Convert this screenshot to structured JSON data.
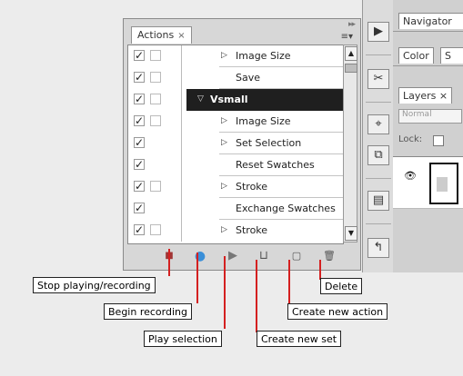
{
  "actions_panel": {
    "tab_label": "Actions",
    "tab_close": "×",
    "menu_glyph": "▸▸",
    "rows": [
      {
        "label": "Image Size",
        "checked": "✓",
        "expand": "▷",
        "indent": 1,
        "highlight": false
      },
      {
        "label": "Save",
        "checked": "✓",
        "expand": "",
        "indent": 1,
        "highlight": false
      },
      {
        "label": "Vsmall",
        "checked": "✓",
        "expand": "▽",
        "indent": 0,
        "highlight": true
      },
      {
        "label": "Image Size",
        "checked": "✓",
        "expand": "▷",
        "indent": 1,
        "highlight": false
      },
      {
        "label": "Set Selection",
        "checked": "✓",
        "expand": "▷",
        "indent": 1,
        "highlight": false
      },
      {
        "label": "Reset Swatches",
        "checked": "✓",
        "expand": "",
        "indent": 1,
        "highlight": false
      },
      {
        "label": "Stroke",
        "checked": "✓",
        "expand": "▷",
        "indent": 1,
        "highlight": false
      },
      {
        "label": "Exchange Swatches",
        "checked": "✓",
        "expand": "",
        "indent": 1,
        "highlight": false
      },
      {
        "label": "Stroke",
        "checked": "✓",
        "expand": "▷",
        "indent": 1,
        "highlight": false
      }
    ],
    "buttons": {
      "stop_icon": "■",
      "record_icon": "●",
      "play_icon": "▶",
      "new_set_icon": "⊔",
      "new_action_icon": "▢",
      "delete_icon": "🗑"
    }
  },
  "right_panels": {
    "navigator_tab": "Navigator",
    "color_tab": "Color",
    "swatches_tab_partial": "S",
    "layers_tab": "Layers",
    "layers_close": "×",
    "blend_mode": "Normal",
    "lock_label": "Lock:"
  },
  "callouts": {
    "stop": "Stop playing/recording",
    "record": "Begin recording",
    "play": "Play selection",
    "new_set": "Create new set",
    "new_action": "Create new action",
    "delete": "Delete"
  },
  "colors": {
    "leader_red": "#d42020",
    "selection_black": "#1f1f1f",
    "record_blue": "#3a8fd8"
  }
}
